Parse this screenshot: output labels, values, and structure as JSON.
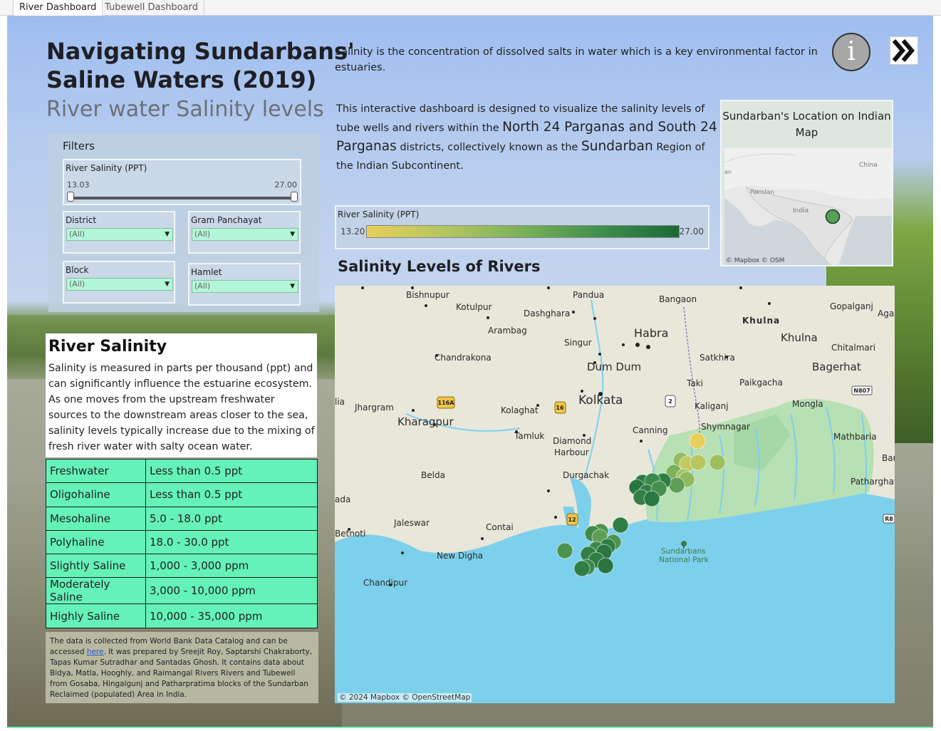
{
  "tabs": [
    {
      "label": "River Dashboard",
      "active": true
    },
    {
      "label": "Tubewell Dashboard",
      "active": false
    }
  ],
  "header": {
    "title_line1": "Navigating Sundarbans'",
    "title_line2": "Saline Waters (2019)",
    "subtitle": "River water Salinity levels"
  },
  "intro": "Salinity is the concentration of dissolved salts in water which is a key environmental factor in estuaries.",
  "description": {
    "part1": "This interactive dashboard is designed to visualize the salinity levels of tube wells and rivers within the ",
    "districts": "North 24 Parganas and South 24 Parganas",
    "part2": " districts, collectively known as the ",
    "region": "Sundarban",
    "part3": " Region of the Indian Subcontinent."
  },
  "buttons": {
    "info_glyph": "i",
    "next_glyph": "»"
  },
  "filters": {
    "title": "Filters",
    "slider": {
      "label": "River Salinity (PPT)",
      "min": "13.03",
      "max": "27.00"
    },
    "district": {
      "label": "District",
      "value": "(All)"
    },
    "gram_panchayat": {
      "label": "Gram Panchayat",
      "value": "(All)"
    },
    "block": {
      "label": "Block",
      "value": "(All)"
    },
    "hamlet": {
      "label": "Hamlet",
      "value": "(All)"
    }
  },
  "river_salinity": {
    "title": "River Salinity",
    "text": "Salinity is measured in parts per thousand (ppt) and can significantly influence the estuarine ecosystem. As one moves from the upstream freshwater sources to the downstream areas closer to the sea, salinity levels typically increase due to the mixing of fresh river water with salty ocean water."
  },
  "salinity_table": [
    {
      "type": "Freshwater",
      "range": "Less than 0.5 ppt"
    },
    {
      "type": "Oligohaline",
      "range": "Less than 0.5 ppt"
    },
    {
      "type": "Mesohaline",
      "range": "5.0 - 18.0 ppt"
    },
    {
      "type": "Polyhaline",
      "range": "18.0 - 30.0 ppt"
    },
    {
      "type": "Slightly Saline",
      "range": "1,000 - 3,000 ppm"
    },
    {
      "type": "Moderately Saline",
      "range": "3,000 - 10,000 ppm"
    },
    {
      "type": "Highly Saline",
      "range": "10,000 - 35,000 ppm"
    }
  ],
  "source": {
    "pre_link": "The data is collected from World Bank Data Catalog and can be accessed ",
    "link": "here",
    "post_link": ". It was prepared by Sreejit Roy, Saptarshi Chakraborty, Tapas Kumar Sutradhar and Santadas Ghosh. It contains data about Bidya, Matla, Hooghly, and Raimangal Rivers Rivers and Tubewell from Gosaba, Hingalgunj and Patharpratima blocks of the Sundarban Reclaimed (populated) Area in India."
  },
  "legend": {
    "label": "River Salinity (PPT)",
    "min": "13.20",
    "max": "27.00",
    "colors": [
      "#e8cf5a",
      "#1b6a38"
    ]
  },
  "map": {
    "title": "Salinity Levels of Rivers",
    "credit": "© 2024 Mapbox  © OpenStreetMap",
    "place_labels": [
      "Bishnupur",
      "Pandua",
      "Bangaon",
      "Kotulpur",
      "Dashghara",
      "Gopalganj",
      "Aga",
      "Khulna",
      "Arambag",
      "Habra",
      "Khulna",
      "Singur",
      "Chitalmari",
      "Chandrakona",
      "Satkhira",
      "Bagerhat",
      "Dum Dum",
      "Paikgacha",
      "Taki",
      "Jhargram",
      "Kolkata",
      "Kaliganj",
      "Mongla",
      "Kolaghat",
      "Kharagpur",
      "Shymnagar",
      "Mathbaria",
      "Tamluk",
      "Canning",
      "Diamond Harbour",
      "Barg",
      "Belda",
      "Durgachak",
      "Patharghata",
      "ada",
      "Jaleswar",
      "Contai",
      "Betnoti",
      "New Digha",
      "Sundarbans National Park",
      "Chandipur",
      "lia"
    ],
    "road_badges": [
      "116A",
      "16",
      "2",
      "12",
      "N807",
      "R8"
    ]
  },
  "mini_map": {
    "title": "Sundarban's Location on Indian Map",
    "labels": [
      "China",
      "Pakistan",
      "India",
      "an"
    ],
    "credit": "© Mapbox  © OSM"
  }
}
